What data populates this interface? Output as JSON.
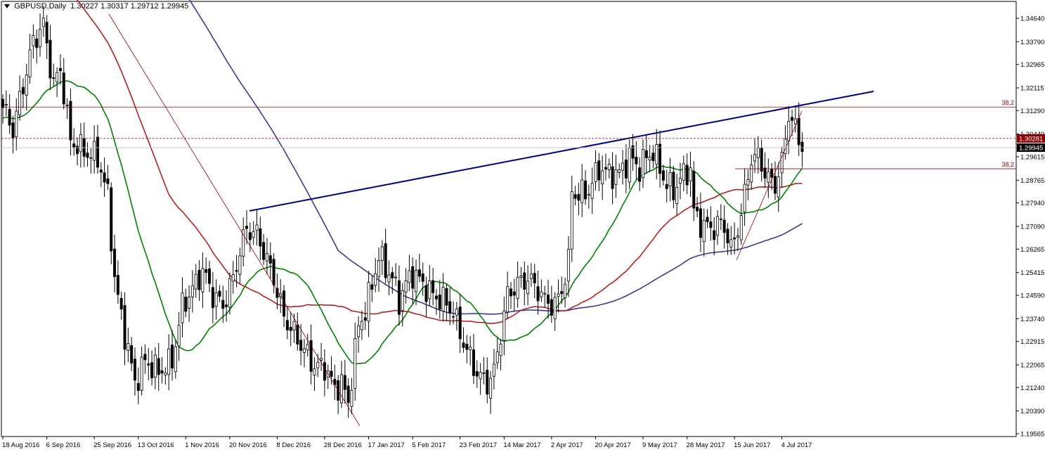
{
  "header": {
    "symbol_label": "GBPUSD,Daily",
    "ohlc": "1.30227 1.30317 1.29712 1.29945"
  },
  "chart_data": {
    "type": "candlestick",
    "symbol": "GBPUSD",
    "timeframe": "Daily",
    "ylim": [
      1.19565,
      1.35
    ]
  },
  "axis": {
    "y_ticks": [
      {
        "label": "1.34640",
        "value": 1.3464
      },
      {
        "label": "1.33790",
        "value": 1.3379
      },
      {
        "label": "1.32965",
        "value": 1.32965
      },
      {
        "label": "1.32115",
        "value": 1.32115
      },
      {
        "label": "1.31290",
        "value": 1.3129
      },
      {
        "label": "1.30440",
        "value": 1.3044
      },
      {
        "label": "1.29615",
        "value": 1.29615
      },
      {
        "label": "1.28765",
        "value": 1.28765
      },
      {
        "label": "1.27940",
        "value": 1.2794
      },
      {
        "label": "1.27090",
        "value": 1.2709
      },
      {
        "label": "1.26265",
        "value": 1.26265
      },
      {
        "label": "1.25415",
        "value": 1.25415
      },
      {
        "label": "1.24590",
        "value": 1.2459
      },
      {
        "label": "1.23740",
        "value": 1.2374
      },
      {
        "label": "1.22915",
        "value": 1.22915
      },
      {
        "label": "1.22065",
        "value": 1.22065
      },
      {
        "label": "1.21240",
        "value": 1.2124
      },
      {
        "label": "1.20390",
        "value": 1.2039
      },
      {
        "label": "1.19565",
        "value": 1.19565
      }
    ],
    "x_ticks": [
      {
        "label": "18 Aug 2016",
        "bar": 0
      },
      {
        "label": "6 Sep 2016",
        "bar": 13
      },
      {
        "label": "25 Sep 2016",
        "bar": 27
      },
      {
        "label": "13 Oct 2016",
        "bar": 40
      },
      {
        "label": "1 Nov 2016",
        "bar": 54
      },
      {
        "label": "20 Nov 2016",
        "bar": 67
      },
      {
        "label": "8 Dec 2016",
        "bar": 81
      },
      {
        "label": "28 Dec 2016",
        "bar": 95
      },
      {
        "label": "17 Jan 2017",
        "bar": 108
      },
      {
        "label": "5 Feb 2017",
        "bar": 121
      },
      {
        "label": "23 Feb 2017",
        "bar": 135
      },
      {
        "label": "14 Mar 2017",
        "bar": 148
      },
      {
        "label": "2 Apr 2017",
        "bar": 162
      },
      {
        "label": "20 Apr 2017",
        "bar": 175
      },
      {
        "label": "9 May 2017",
        "bar": 189
      },
      {
        "label": "28 May 2017",
        "bar": 202
      },
      {
        "label": "15 Jun 2017",
        "bar": 216
      },
      {
        "label": "4 Jul 2017",
        "bar": 230
      }
    ]
  },
  "price_tags": {
    "ask_label": "1.30281",
    "ask_value": 1.30281,
    "ask_color": "#8b0000",
    "bid_label": "1.29945",
    "bid_value": 1.29945,
    "bid_color": "#000000"
  },
  "fib_levels": [
    {
      "label": "38.2",
      "value": 1.3142,
      "color": "#8b0000"
    },
    {
      "label": "38.2",
      "value": 1.2918,
      "color": "#8b0000"
    }
  ],
  "colors": {
    "bull_body": "#ffffff",
    "bear_body": "#000000",
    "wick": "#000000",
    "ma_short": "#008000",
    "ma_mid": "#b22222",
    "ma_long": "#3c3c8c",
    "trendline": "#000080",
    "fib_line": "#8b0000"
  }
}
